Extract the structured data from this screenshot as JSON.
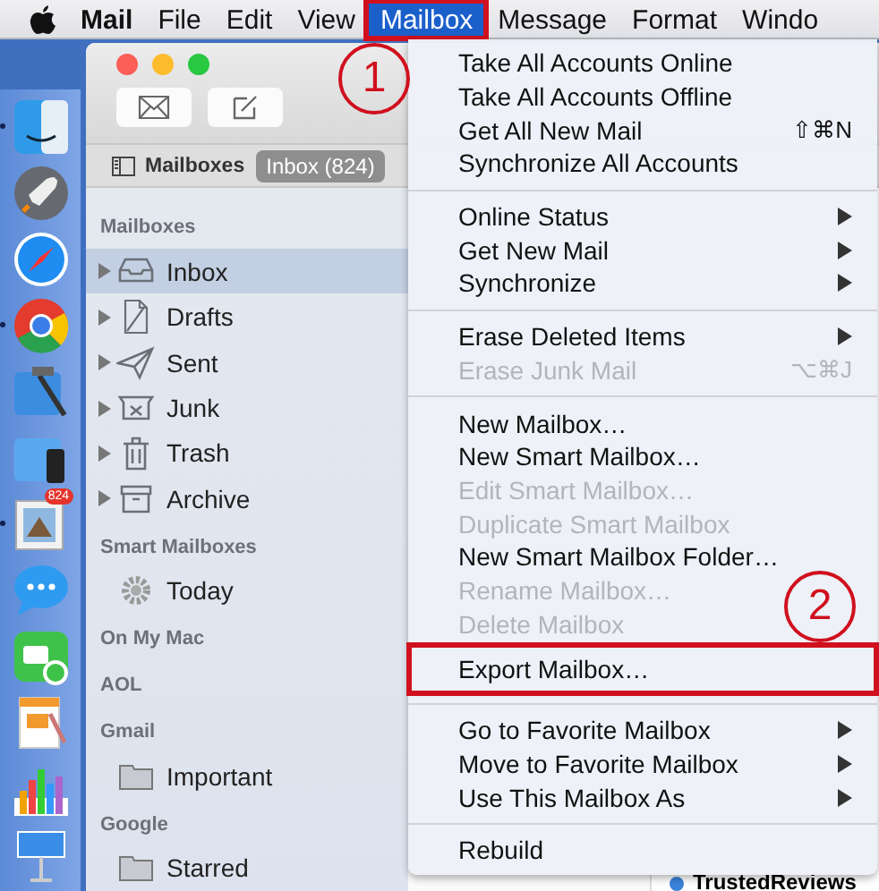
{
  "menu_bar": {
    "items": [
      {
        "label": "Mail",
        "bold": true,
        "selected": false,
        "outlined": false
      },
      {
        "label": "File",
        "bold": false,
        "selected": false,
        "outlined": false
      },
      {
        "label": "Edit",
        "bold": false,
        "selected": false,
        "outlined": false
      },
      {
        "label": "View",
        "bold": false,
        "selected": false,
        "outlined": false
      },
      {
        "label": "Mailbox",
        "bold": false,
        "selected": true,
        "outlined": true
      },
      {
        "label": "Message",
        "bold": false,
        "selected": false,
        "outlined": false
      },
      {
        "label": "Format",
        "bold": false,
        "selected": false,
        "outlined": false
      },
      {
        "label": "Windo",
        "bold": false,
        "selected": false,
        "outlined": false
      }
    ]
  },
  "dock": {
    "mail_badge": "824"
  },
  "mail_window": {
    "toolbar": {
      "mailboxes_button": "Mailboxes",
      "inbox_button": "Inbox (824)"
    },
    "sidebar": {
      "sections": [
        {
          "heading": "Mailboxes",
          "items": [
            {
              "label": "Inbox",
              "kind": "inbox",
              "expandable": true,
              "selected": true
            },
            {
              "label": "Drafts",
              "kind": "drafts",
              "expandable": true,
              "selected": false
            },
            {
              "label": "Sent",
              "kind": "sent",
              "expandable": true,
              "selected": false
            },
            {
              "label": "Junk",
              "kind": "junk",
              "expandable": true,
              "selected": false
            },
            {
              "label": "Trash",
              "kind": "trash",
              "expandable": true,
              "selected": false
            },
            {
              "label": "Archive",
              "kind": "archive",
              "expandable": true,
              "selected": false
            }
          ]
        },
        {
          "heading": "Smart Mailboxes",
          "items": [
            {
              "label": "Today",
              "kind": "smart",
              "expandable": false,
              "selected": false
            }
          ]
        },
        {
          "heading": "On My Mac"
        },
        {
          "heading": "AOL"
        },
        {
          "heading": "Gmail",
          "items": [
            {
              "label": "Important",
              "kind": "folder",
              "expandable": false,
              "selected": false
            }
          ]
        },
        {
          "heading": "Google",
          "items": [
            {
              "label": "Starred",
              "kind": "folder",
              "expandable": false,
              "selected": false
            }
          ]
        }
      ]
    },
    "message_list": {
      "rows": [
        {
          "sender": "TrustedReviews",
          "unread": true
        }
      ]
    }
  },
  "mailbox_menu": {
    "groups": [
      [
        {
          "label": "Take All Accounts Online",
          "disabled": false,
          "submenu": false,
          "outlined": false
        },
        {
          "label": "Take All Accounts Offline",
          "disabled": false,
          "submenu": false,
          "outlined": false
        },
        {
          "label": "Get All New Mail",
          "shortcut": "⇧⌘N",
          "disabled": false,
          "submenu": false,
          "outlined": false
        },
        {
          "label": "Synchronize All Accounts",
          "disabled": false,
          "submenu": false,
          "outlined": false
        }
      ],
      [
        {
          "label": "Online Status",
          "disabled": false,
          "submenu": true,
          "outlined": false
        },
        {
          "label": "Get New Mail",
          "disabled": false,
          "submenu": true,
          "outlined": false
        },
        {
          "label": "Synchronize",
          "disabled": false,
          "submenu": true,
          "outlined": false
        }
      ],
      [
        {
          "label": "Erase Deleted Items",
          "disabled": false,
          "submenu": true,
          "outlined": false
        },
        {
          "label": "Erase Junk Mail",
          "shortcut": "⌥⌘J",
          "disabled": true,
          "submenu": false,
          "outlined": false
        }
      ],
      [
        {
          "label": "New Mailbox…",
          "disabled": false,
          "submenu": false,
          "outlined": false
        },
        {
          "label": "New Smart Mailbox…",
          "disabled": false,
          "submenu": false,
          "outlined": false
        },
        {
          "label": "Edit Smart Mailbox…",
          "disabled": true,
          "submenu": false,
          "outlined": false
        },
        {
          "label": "Duplicate Smart Mailbox",
          "disabled": true,
          "submenu": false,
          "outlined": false
        },
        {
          "label": "New Smart Mailbox Folder…",
          "disabled": false,
          "submenu": false,
          "outlined": false
        },
        {
          "label": "Rename Mailbox…",
          "disabled": true,
          "submenu": false,
          "outlined": false
        },
        {
          "label": "Delete Mailbox",
          "disabled": true,
          "submenu": false,
          "outlined": false
        },
        {
          "label": "Export Mailbox…",
          "disabled": false,
          "submenu": false,
          "outlined": true
        }
      ],
      [
        {
          "label": "Go to Favorite Mailbox",
          "disabled": false,
          "submenu": true,
          "outlined": false
        },
        {
          "label": "Move to Favorite Mailbox",
          "disabled": false,
          "submenu": true,
          "outlined": false
        },
        {
          "label": "Use This Mailbox As",
          "disabled": false,
          "submenu": true,
          "outlined": false
        }
      ],
      [
        {
          "label": "Rebuild",
          "disabled": false,
          "submenu": false,
          "outlined": false
        }
      ]
    ]
  },
  "annotations": [
    {
      "label": "1"
    },
    {
      "label": "2"
    }
  ]
}
